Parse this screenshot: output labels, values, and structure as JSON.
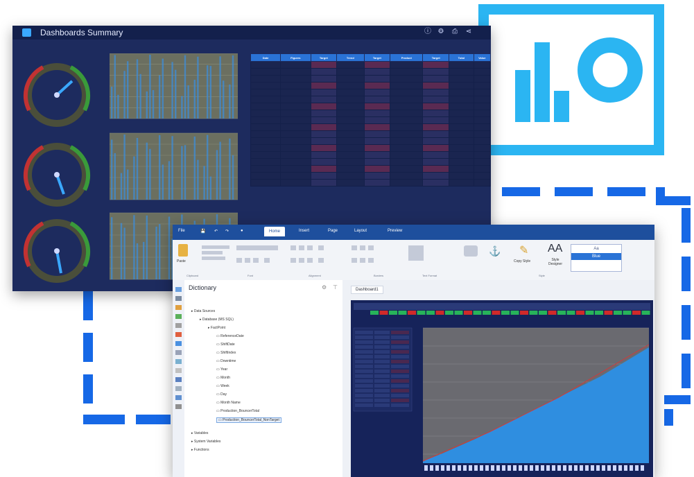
{
  "dashboard": {
    "title": "Dashboards Summary",
    "gauges": [
      {
        "label": "",
        "needle": 0.62
      },
      {
        "label": "",
        "needle": 0.55
      },
      {
        "label": "",
        "needle": 0.5
      }
    ],
    "table_headers": [
      "Date",
      "Figures",
      "Target",
      "Trend",
      "Target",
      "Product",
      "Target",
      "Total",
      "Value"
    ],
    "table_rows": 18
  },
  "designer": {
    "tabs": [
      "File",
      "Home",
      "Insert",
      "Page",
      "Layout",
      "Preview"
    ],
    "active_tab": "Home",
    "ribbon": {
      "paste": "Paste",
      "clipboard": "Clipboard",
      "font": "Font",
      "alignment": "Alignment",
      "borders": "Borders",
      "text_format": "Text Format",
      "style": "Style",
      "copy_style": "Copy Style",
      "style_designer": "Style Designer",
      "style_sample": "Blue"
    },
    "dictionary": {
      "title": "Dictionary",
      "tree": [
        {
          "label": "Data Sources",
          "level": 0
        },
        {
          "label": "Database (MS SQL)",
          "level": 1
        },
        {
          "label": "FactPoint",
          "level": 2
        },
        {
          "label": "ReferenceDate",
          "level": 3
        },
        {
          "label": "ShiftDate",
          "level": 3
        },
        {
          "label": "ShiftIndex",
          "level": 3
        },
        {
          "label": "Downtime",
          "level": 3
        },
        {
          "label": "Year",
          "level": 3
        },
        {
          "label": "Month",
          "level": 3
        },
        {
          "label": "Week",
          "level": 3
        },
        {
          "label": "Day",
          "level": 3
        },
        {
          "label": "Month Name",
          "level": 3
        },
        {
          "label": "Production_BouncerTotal",
          "level": 3
        },
        {
          "label": "Production_BouncerTotal_NonTarget",
          "level": 3
        },
        {
          "label": "Variables",
          "level": 0
        },
        {
          "label": "System Variables",
          "level": 0
        },
        {
          "label": "Functions",
          "level": 0
        }
      ]
    },
    "page_tab": "Dashboard1"
  },
  "colors": {
    "accent": "#2bb5f2",
    "dashed": "#1668e6",
    "dash_bg": "#1d2b5e"
  }
}
